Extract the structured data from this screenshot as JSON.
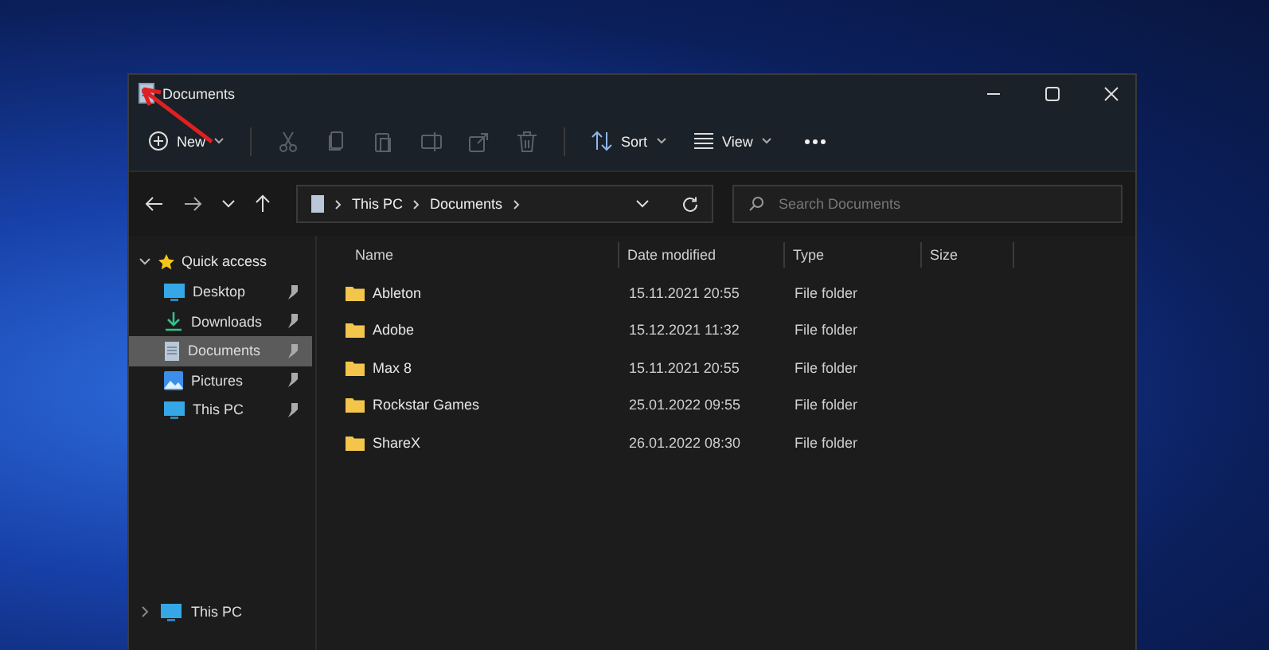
{
  "window": {
    "title": "Documents"
  },
  "toolbar": {
    "new_label": "New",
    "actions": [
      {
        "kind": "cut",
        "disabled": true
      },
      {
        "kind": "copy",
        "disabled": true
      },
      {
        "kind": "paste",
        "disabled": true
      },
      {
        "kind": "rename",
        "disabled": true
      },
      {
        "kind": "share",
        "disabled": true
      },
      {
        "kind": "delete",
        "disabled": true
      }
    ],
    "sort_label": "Sort",
    "view_label": "View"
  },
  "address": {
    "crumbs": [
      "This PC",
      "Documents"
    ]
  },
  "search": {
    "placeholder": "Search Documents"
  },
  "sidebar": {
    "quick_access": {
      "label": "Quick access",
      "expanded": true,
      "items": [
        {
          "name": "Desktop",
          "kind": "desktop",
          "selected": false
        },
        {
          "name": "Downloads",
          "kind": "downloads",
          "selected": false
        },
        {
          "name": "Documents",
          "kind": "documents",
          "selected": true
        },
        {
          "name": "Pictures",
          "kind": "pictures",
          "selected": false
        },
        {
          "name": "This PC",
          "kind": "desktop",
          "selected": false
        }
      ]
    },
    "this_pc": {
      "label": "This PC",
      "expanded": false
    }
  },
  "table": {
    "columns": [
      "Name",
      "Date modified",
      "Type",
      "Size"
    ],
    "rows": [
      {
        "name": "Ableton",
        "date": "15.11.2021 20:55",
        "type": "File folder"
      },
      {
        "name": "Adobe",
        "date": "15.12.2021 11:32",
        "type": "File folder"
      },
      {
        "name": "Max 8",
        "date": "15.11.2021 20:55",
        "type": "File folder"
      },
      {
        "name": "Rockstar Games",
        "date": "25.01.2022 09:55",
        "type": "File folder"
      },
      {
        "name": "ShareX",
        "date": "26.01.2022 08:30",
        "type": "File folder"
      }
    ]
  }
}
